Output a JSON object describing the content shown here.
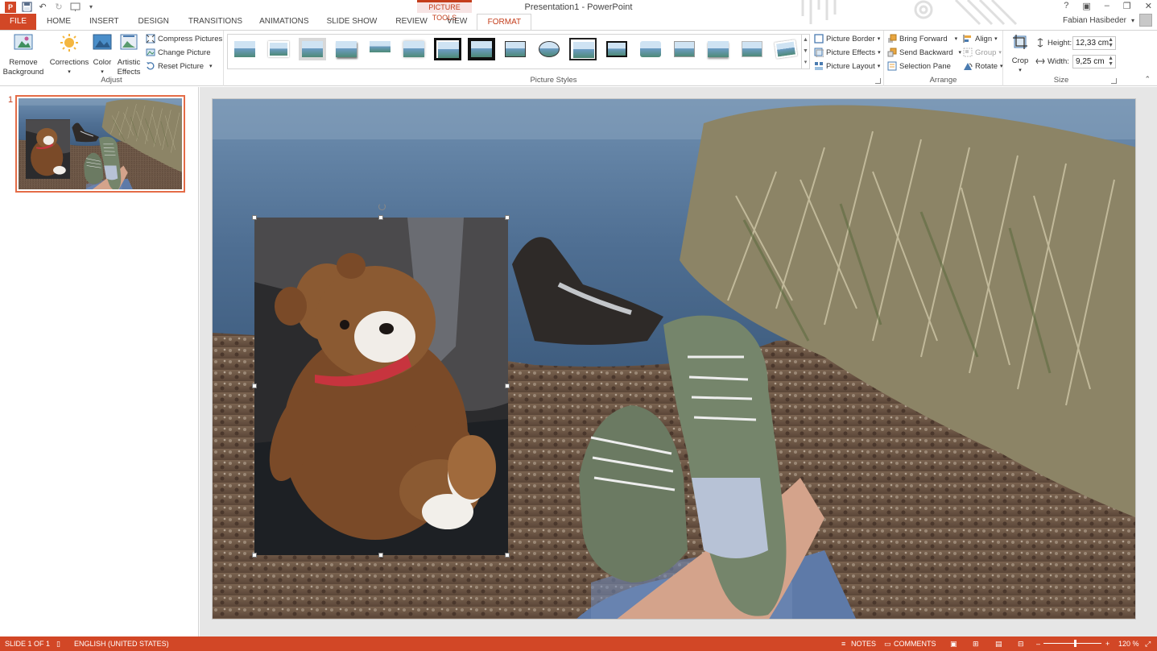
{
  "window": {
    "title": "Presentation1 - PowerPoint",
    "contextual_group": "PICTURE TOOLS",
    "user_name": "Fabian Hasibeder",
    "help": "?"
  },
  "tabs": [
    {
      "label": "FILE"
    },
    {
      "label": "HOME"
    },
    {
      "label": "INSERT"
    },
    {
      "label": "DESIGN"
    },
    {
      "label": "TRANSITIONS"
    },
    {
      "label": "ANIMATIONS"
    },
    {
      "label": "SLIDE SHOW"
    },
    {
      "label": "REVIEW"
    },
    {
      "label": "VIEW"
    },
    {
      "label": "FORMAT"
    }
  ],
  "ribbon": {
    "adjust": {
      "label": "Adjust",
      "remove_background": "Remove Background",
      "corrections": "Corrections",
      "color": "Color",
      "artistic_effects": "Artistic Effects",
      "compress_pictures": "Compress Pictures",
      "change_picture": "Change Picture",
      "reset_picture": "Reset Picture"
    },
    "picture_styles": {
      "label": "Picture Styles",
      "picture_border": "Picture Border",
      "picture_effects": "Picture Effects",
      "picture_layout": "Picture Layout"
    },
    "arrange": {
      "label": "Arrange",
      "bring_forward": "Bring Forward",
      "send_backward": "Send Backward",
      "selection_pane": "Selection Pane",
      "align": "Align",
      "group": "Group",
      "rotate": "Rotate"
    },
    "size": {
      "label": "Size",
      "crop": "Crop",
      "height_label": "Height:",
      "height_value": "12,33 cm",
      "width_label": "Width:",
      "width_value": "9,25 cm"
    }
  },
  "slides_pane": {
    "slide_number": "1"
  },
  "statusbar": {
    "slide_info": "SLIDE 1 OF 1",
    "language": "ENGLISH (UNITED STATES)",
    "notes": "NOTES",
    "comments": "COMMENTS",
    "zoom": "120 %",
    "zoom_level": 0.55
  },
  "colors": {
    "accent": "#d24726",
    "tab_active": "#c43e1c"
  }
}
